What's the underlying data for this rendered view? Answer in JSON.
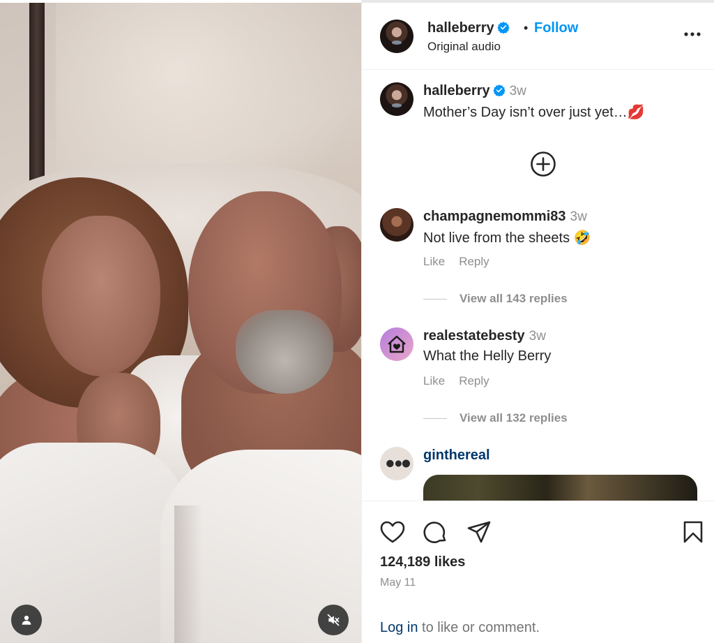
{
  "post": {
    "username": "halleberry",
    "follow_label": "Follow",
    "dot": "•",
    "audio": "Original audio"
  },
  "caption": {
    "username": "halleberry",
    "time": "3w",
    "text": "Mother’s Day isn’t over just yet…💋"
  },
  "comments": [
    {
      "username": "champagnemommi83",
      "time": "3w",
      "text": "Not live from the sheets 🤣",
      "like_label": "Like",
      "reply_label": "Reply",
      "replies_label": "View all 143 replies"
    },
    {
      "username": "realestatebesty",
      "time": "3w",
      "text": "What the Helly Berry",
      "like_label": "Like",
      "reply_label": "Reply",
      "replies_label": "View all 132 replies"
    },
    {
      "username": "ginthereal"
    }
  ],
  "stats": {
    "likes": "124,189 likes",
    "date": "May 11"
  },
  "login_prompt": {
    "link": "Log in",
    "rest": " to like or comment."
  },
  "colors": {
    "accent": "#0095f6",
    "verified": "#0095f6",
    "link": "#00376b",
    "muted": "#8e8e8e"
  },
  "icons": [
    "verified-badge-icon",
    "more-options-icon",
    "add-circle-icon",
    "heart-icon",
    "comment-icon",
    "share-icon",
    "bookmark-icon",
    "user-tag-icon",
    "muted-speaker-icon"
  ]
}
